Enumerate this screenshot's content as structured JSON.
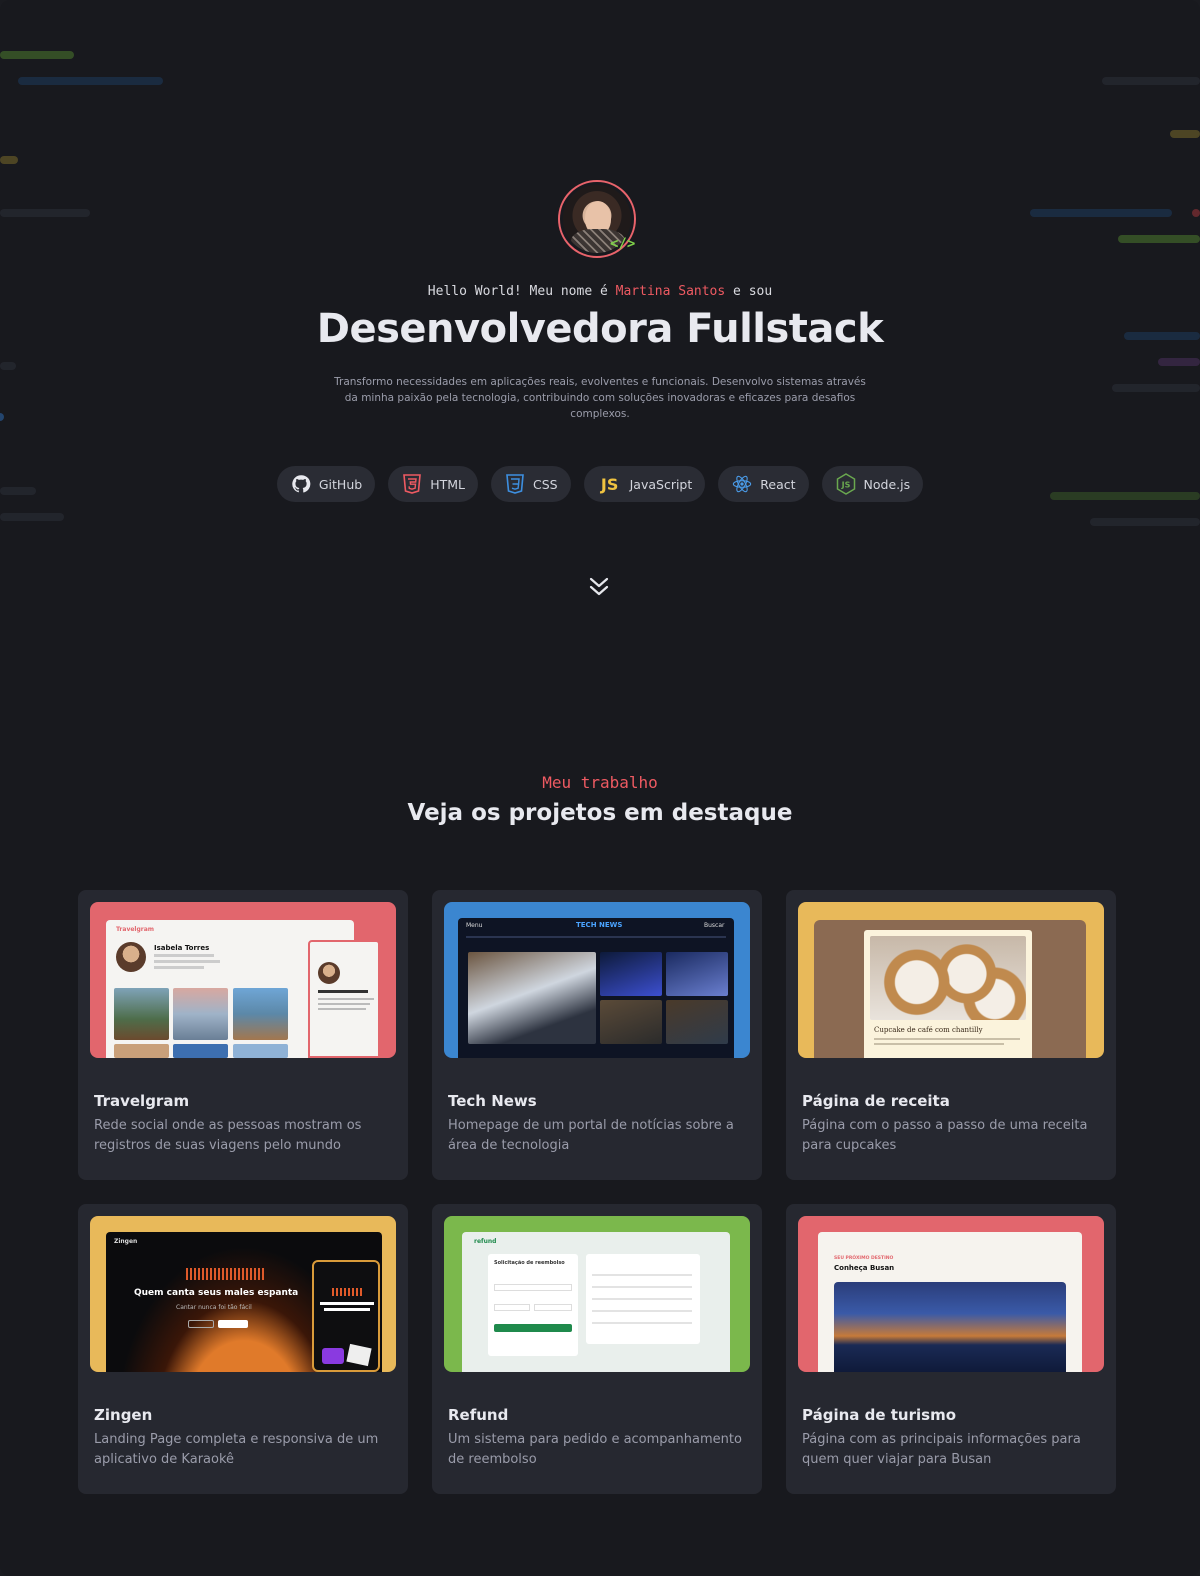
{
  "hero": {
    "greeting_prefix": "Hello World! Meu nome é",
    "name": "Martina Santos",
    "greeting_suffix": "e sou",
    "title": "Desenvolvedora Fullstack",
    "description": "Transformo necessidades em aplicações reais, evolventes e funcionais. Desenvolvo sistemas através da minha paixão pela tecnologia, contribuindo com soluções inovadoras e eficazes para desafios complexos.",
    "avatar_badge": "</>"
  },
  "skills": [
    {
      "label": "GitHub",
      "icon": "github-icon"
    },
    {
      "label": "HTML",
      "icon": "html5-icon"
    },
    {
      "label": "CSS",
      "icon": "css3-icon"
    },
    {
      "label": "JavaScript",
      "icon": "javascript-icon"
    },
    {
      "label": "React",
      "icon": "react-icon"
    },
    {
      "label": "Node.js",
      "icon": "nodejs-icon"
    }
  ],
  "projects_section": {
    "eyebrow": "Meu trabalho",
    "title": "Veja os projetos em destaque"
  },
  "projects": [
    {
      "title": "Travelgram",
      "description": "Rede social onde as pessoas mostram os registros de suas viagens pelo mundo",
      "thumb": {
        "app": "Travelgram",
        "user": "Isabela Torres"
      }
    },
    {
      "title": "Tech News",
      "description": "Homepage de um portal de notícias sobre a área de tecnologia",
      "thumb": {
        "app": "TECH NEWS",
        "menu": "Menu",
        "search": "Buscar"
      }
    },
    {
      "title": "Página de receita",
      "description": "Página com o passo a passo de uma receita para cupcakes",
      "thumb": {
        "heading": "Cupcake de café com chantilly"
      }
    },
    {
      "title": "Zingen",
      "description": "Landing Page completa e responsiva de um aplicativo de Karaokê",
      "thumb": {
        "app": "Zingen",
        "headline": "Quem canta seus males espanta",
        "sub": "Cantar nunca foi tão fácil"
      }
    },
    {
      "title": "Refund",
      "description": "Um sistema para pedido e acompanhamento de reembolso",
      "thumb": {
        "app": "refund",
        "heading": "Solicitação de reembolso"
      }
    },
    {
      "title": "Página de turismo",
      "description": "Página com as principais informações para quem quer viajar para Busan",
      "thumb": {
        "eyebrow": "SEU PRÓXIMO DESTINO",
        "heading": "Conheça Busan"
      }
    }
  ],
  "colors": {
    "accent": "#ee5a62",
    "background": "#18191e",
    "card": "#262830"
  }
}
